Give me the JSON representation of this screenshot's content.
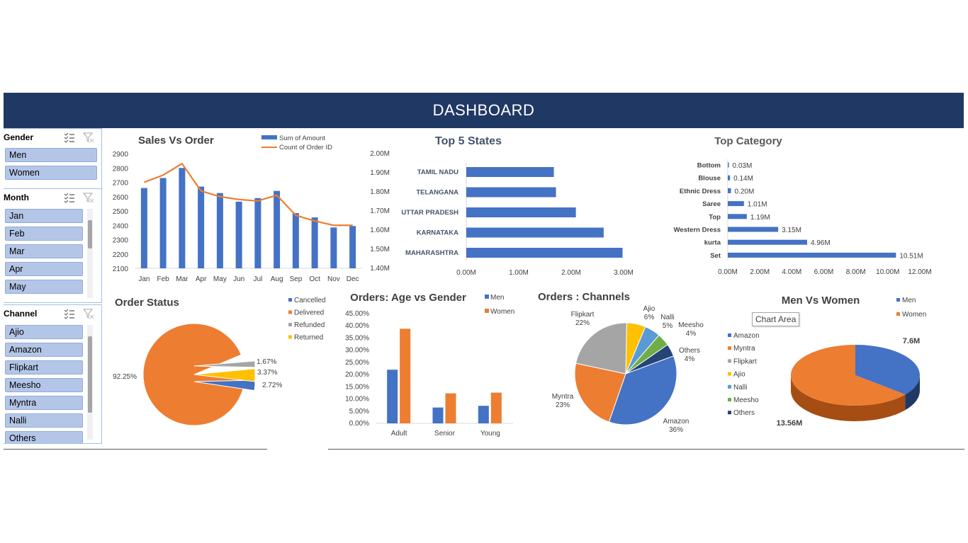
{
  "dashboard": {
    "title": "DASHBOARD"
  },
  "slicers": {
    "gender": {
      "title": "Gender",
      "items": [
        "Men",
        "Women"
      ]
    },
    "month": {
      "title": "Month",
      "items": [
        "Jan",
        "Feb",
        "Mar",
        "Apr",
        "May"
      ]
    },
    "channel": {
      "title": "Channel",
      "items": [
        "Ajio",
        "Amazon",
        "Flipkart",
        "Meesho",
        "Myntra",
        "Nalli",
        "Others"
      ]
    },
    "icons": {
      "multiselect": "multi-select-icon",
      "clear": "clear-filter-icon"
    }
  },
  "tooltip": "Chart Area",
  "colors": {
    "blue": "#4472c4",
    "orange": "#ed7d31",
    "gray": "#a5a5a5",
    "yellow": "#ffc000",
    "lightblue": "#5b9bd5",
    "green": "#70ad47",
    "navy": "#264478",
    "banner": "#203864"
  },
  "chart_data": [
    {
      "id": "sales_vs_order",
      "type": "bar",
      "title": "Sales Vs Order",
      "categories": [
        "Jan",
        "Feb",
        "Mar",
        "Apr",
        "May",
        "Jun",
        "Jul",
        "Aug",
        "Sep",
        "Oct",
        "Nov",
        "Dec"
      ],
      "ylim": [
        2100,
        2900
      ],
      "yticks": [
        "2900",
        "2800",
        "2700",
        "2600",
        "2500",
        "2400",
        "2300",
        "2200",
        "2100"
      ],
      "series": [
        {
          "name": "Sum of Amount",
          "type": "bar",
          "values": [
            2660,
            2730,
            2800,
            2670,
            2625,
            2565,
            2590,
            2640,
            2485,
            2455,
            2385,
            2395
          ]
        },
        {
          "name": "Count of Order ID",
          "type": "line",
          "values": [
            2700,
            2750,
            2830,
            2640,
            2600,
            2580,
            2570,
            2610,
            2470,
            2430,
            2400,
            2400
          ]
        }
      ],
      "legend": "top"
    },
    {
      "id": "top_states",
      "type": "bar",
      "orientation": "horizontal",
      "title": "Top 5 States",
      "categories": [
        "TAMIL NADU",
        "TELANGANA",
        "UTTAR PRADESH",
        "KARNATAKA",
        "MAHARASHTRA"
      ],
      "values": [
        1.67,
        1.71,
        2.09,
        2.62,
        2.98
      ],
      "xlim": [
        0,
        3.0
      ],
      "xticks": [
        "0.00M",
        "1.00M",
        "2.00M",
        "3.00M"
      ],
      "yticks": [
        "2.00M",
        "1.90M",
        "1.80M",
        "1.70M",
        "1.60M",
        "1.50M",
        "1.40M"
      ]
    },
    {
      "id": "top_category",
      "type": "bar",
      "orientation": "horizontal",
      "title": "Top Category",
      "categories": [
        "Bottom",
        "Blouse",
        "Ethnic Dress",
        "Saree",
        "Top",
        "Western Dress",
        "kurta",
        "Set"
      ],
      "values": [
        0.03,
        0.14,
        0.2,
        1.01,
        1.19,
        3.15,
        4.96,
        10.51
      ],
      "labels": [
        "0.03M",
        "0.14M",
        "0.20M",
        "1.01M",
        "1.19M",
        "3.15M",
        "4.96M",
        "10.51M"
      ],
      "xlim": [
        0,
        12
      ],
      "xticks": [
        "0.00M",
        "2.00M",
        "4.00M",
        "6.00M",
        "8.00M",
        "10.00M",
        "12.00M"
      ]
    },
    {
      "id": "order_status",
      "type": "pie",
      "title": "Order Status",
      "categories": [
        "Cancelled",
        "Delivered",
        "Refunded",
        "Returned"
      ],
      "values": [
        2.72,
        92.25,
        1.67,
        3.37
      ],
      "labels": [
        "2.72%",
        "92.25%",
        "1.67%",
        "3.37%"
      ],
      "legend": "right"
    },
    {
      "id": "age_vs_gender",
      "type": "bar",
      "title": "Orders: Age vs Gender",
      "categories": [
        "Adult",
        "Senior",
        "Young"
      ],
      "series": [
        {
          "name": "Men",
          "values": [
            22.0,
            6.5,
            7.2
          ]
        },
        {
          "name": "Women",
          "values": [
            38.8,
            12.3,
            12.6
          ]
        }
      ],
      "ylim": [
        0,
        45
      ],
      "yticks": [
        "45.00%",
        "40.00%",
        "35.00%",
        "30.00%",
        "25.00%",
        "20.00%",
        "15.00%",
        "10.00%",
        "5.00%",
        "0.00%"
      ],
      "legend": "top-right"
    },
    {
      "id": "channels",
      "type": "pie",
      "title": "Orders : Channels",
      "categories": [
        "Amazon",
        "Myntra",
        "Flipkart",
        "Ajio",
        "Nalli",
        "Meesho",
        "Others"
      ],
      "values": [
        36,
        23,
        22,
        6,
        5,
        4,
        4
      ],
      "labels": [
        "36%",
        "23%",
        "22%",
        "6%",
        "5%",
        "4%",
        "4%"
      ]
    },
    {
      "id": "men_vs_women",
      "type": "pie",
      "title": "Men Vs Women",
      "categories": [
        "Men",
        "Women"
      ],
      "values": [
        7.6,
        13.56
      ],
      "labels": [
        "7.6M",
        "13.56M"
      ],
      "legend_top": [
        "Men",
        "Women"
      ],
      "legend_left": [
        "Amazon",
        "Myntra",
        "Flipkart",
        "Ajio",
        "Nalli",
        "Meesho",
        "Others"
      ]
    }
  ]
}
